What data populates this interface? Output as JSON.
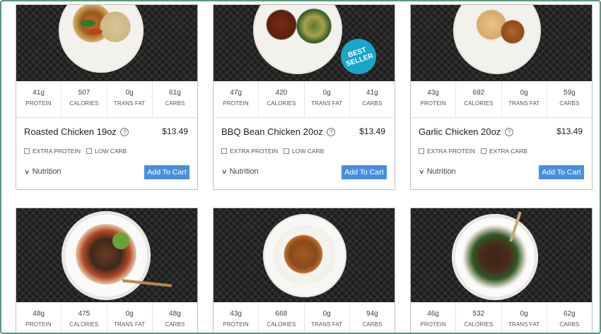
{
  "products": [
    {
      "name": "Roasted Chicken 19oz",
      "price": "$13.49",
      "stats": [
        {
          "value": "41g",
          "label": "PROTEIN"
        },
        {
          "value": "507",
          "label": "CALORIES"
        },
        {
          "value": "0g",
          "label": "TRANS FAT"
        },
        {
          "value": "61g",
          "label": "CARBS"
        }
      ],
      "options": [
        "EXTRA PROTEIN",
        "LOW CARB"
      ],
      "nutrition_label": "Nutrition",
      "cart_label": "Add To Cart"
    },
    {
      "name": "BBQ Bean Chicken 20oz",
      "price": "$13.49",
      "badge": [
        "BEST",
        "SELLER"
      ],
      "stats": [
        {
          "value": "47g",
          "label": "PROTEIN"
        },
        {
          "value": "420",
          "label": "CALORIES"
        },
        {
          "value": "0g",
          "label": "TRANS FAT"
        },
        {
          "value": "41g",
          "label": "CARBS"
        }
      ],
      "options": [
        "EXTRA PROTEIN",
        "LOW CARB"
      ],
      "nutrition_label": "Nutrition",
      "cart_label": "Add To Cart"
    },
    {
      "name": "Garlic Chicken 20oz",
      "price": "$13.49",
      "stats": [
        {
          "value": "43g",
          "label": "PROTEIN"
        },
        {
          "value": "692",
          "label": "CALORIES"
        },
        {
          "value": "0g",
          "label": "TRANS FAT"
        },
        {
          "value": "59g",
          "label": "CARBS"
        }
      ],
      "options": [
        "EXTRA PROTEIN",
        "EXTRA CARB"
      ],
      "nutrition_label": "Nutrition",
      "cart_label": "Add To Cart"
    },
    {
      "stats": [
        {
          "value": "48g",
          "label": "PROTEIN"
        },
        {
          "value": "475",
          "label": "CALORIES"
        },
        {
          "value": "0g",
          "label": "TRANS FAT"
        },
        {
          "value": "48g",
          "label": "CARBS"
        }
      ]
    },
    {
      "stats": [
        {
          "value": "43g",
          "label": "PROTEIN"
        },
        {
          "value": "668",
          "label": "CALORIES"
        },
        {
          "value": "0g",
          "label": "TRANS FAT"
        },
        {
          "value": "94g",
          "label": "CARBS"
        }
      ]
    },
    {
      "stats": [
        {
          "value": "46g",
          "label": "PROTEIN"
        },
        {
          "value": "532",
          "label": "CALORIES"
        },
        {
          "value": "0g",
          "label": "TRANS FAT"
        },
        {
          "value": "62g",
          "label": "CARBS"
        }
      ]
    }
  ],
  "icons": {
    "help": "help-circle-icon",
    "chevron": "chevron-down-icon",
    "checkbox": "checkbox-icon"
  },
  "colors": {
    "cart_button": "#4a90d9",
    "badge": "#1aa6c9",
    "frame_border": "#5a9a7c"
  }
}
